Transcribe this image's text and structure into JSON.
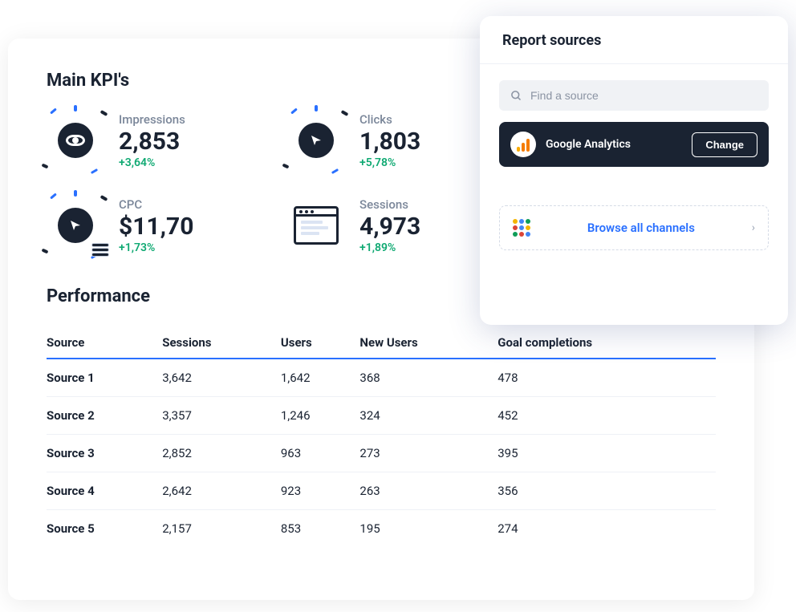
{
  "mainTitle": "Main KPI's",
  "kpis": [
    {
      "label": "Impressions",
      "value": "2,853",
      "change": "+3,64%"
    },
    {
      "label": "Clicks",
      "value": "1,803",
      "change": "+5,78%"
    },
    {
      "label": "CPC",
      "value": "$11,70",
      "change": "+1,73%"
    },
    {
      "label": "Sessions",
      "value": "4,973",
      "change": "+1,89%"
    }
  ],
  "perfTitle": "Performance",
  "columns": [
    "Source",
    "Sessions",
    "Users",
    "New Users",
    "Goal completions"
  ],
  "rows": [
    {
      "c0": "Source 1",
      "c1": "3,642",
      "c2": "1,642",
      "c3": "368",
      "c4": "478"
    },
    {
      "c0": "Source 2",
      "c1": "3,357",
      "c2": "1,246",
      "c3": "324",
      "c4": "452"
    },
    {
      "c0": "Source 3",
      "c1": "2,852",
      "c2": "963",
      "c3": "273",
      "c4": "395"
    },
    {
      "c0": "Source 4",
      "c1": "2,642",
      "c2": "923",
      "c3": "263",
      "c4": "356"
    },
    {
      "c0": "Source 5",
      "c1": "2,157",
      "c2": "853",
      "c3": "195",
      "c4": "274"
    }
  ],
  "panel": {
    "title": "Report sources",
    "searchPlaceholder": "Find a source",
    "selectedSource": "Google Analytics",
    "changeLabel": "Change",
    "browseLabel": "Browse all channels"
  },
  "colors": {
    "accent": "#2a70ff",
    "positive": "#0fa972",
    "dark": "#1a2332"
  }
}
